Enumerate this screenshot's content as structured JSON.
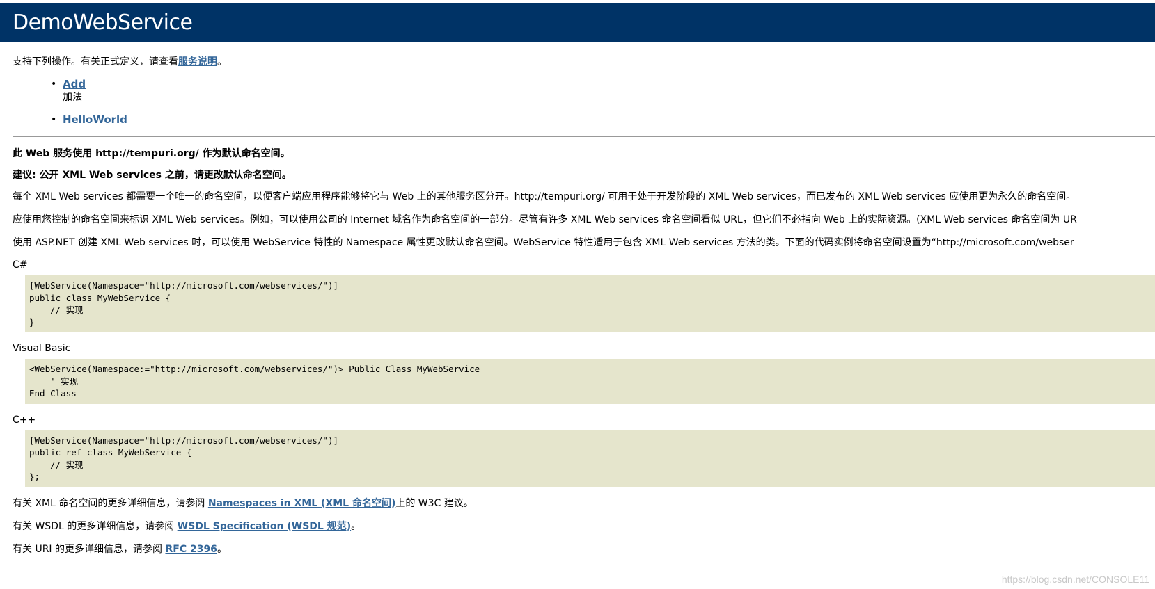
{
  "page": {
    "title": "DemoWebService"
  },
  "intro": {
    "text_before": "支持下列操作。有关正式定义，请查看",
    "link_label": "服务说明",
    "text_after": "。"
  },
  "operations": [
    {
      "name": "Add",
      "description": "加法"
    },
    {
      "name": "HelloWorld",
      "description": ""
    }
  ],
  "namespace_notice": {
    "line1": "此 Web 服务使用 http://tempuri.org/ 作为默认命名空间。",
    "line2": "建议: 公开 XML Web services 之前，请更改默认命名空间。",
    "para1": "每个 XML Web services 都需要一个唯一的命名空间，以便客户端应用程序能够将它与 Web 上的其他服务区分开。http://tempuri.org/ 可用于处于开发阶段的 XML Web services，而已发布的 XML Web services 应使用更为永久的命名空间。",
    "para2": "应使用您控制的命名空间来标识 XML Web services。例如，可以使用公司的 Internet 域名作为命名空间的一部分。尽管有许多 XML Web services 命名空间看似 URL，但它们不必指向 Web 上的实际资源。(XML Web services 命名空间为 UR",
    "para3": "使用 ASP.NET 创建 XML Web services 时，可以使用 WebService 特性的 Namespace 属性更改默认命名空间。WebService 特性适用于包含 XML Web services 方法的类。下面的代码实例将命名空间设置为“http://microsoft.com/webser"
  },
  "code_samples": [
    {
      "language": "C#",
      "code": "[WebService(Namespace=\"http://microsoft.com/webservices/\")]\npublic class MyWebService {\n    // 实现\n}"
    },
    {
      "language": "Visual Basic",
      "code": "<WebService(Namespace:=\"http://microsoft.com/webservices/\")> Public Class MyWebService\n    ' 实现\nEnd Class"
    },
    {
      "language": "C++",
      "code": "[WebService(Namespace=\"http://microsoft.com/webservices/\")]\npublic ref class MyWebService {\n    // 实现\n};"
    }
  ],
  "references": [
    {
      "before": "有关 XML 命名空间的更多详细信息，请参阅 ",
      "link": "Namespaces in XML (XML 命名空间)",
      "after": "上的 W3C 建议。"
    },
    {
      "before": "有关 WSDL 的更多详细信息，请参阅 ",
      "link": "WSDL Specification (WSDL 规范)",
      "after": "。"
    },
    {
      "before": "有关 URI 的更多详细信息，请参阅 ",
      "link": "RFC 2396",
      "after": "。"
    }
  ],
  "watermark": "https://blog.csdn.net/CONSOLE11",
  "colors": {
    "header_bg": "#003366",
    "link": "#336699",
    "code_bg": "#e5e5cc"
  }
}
